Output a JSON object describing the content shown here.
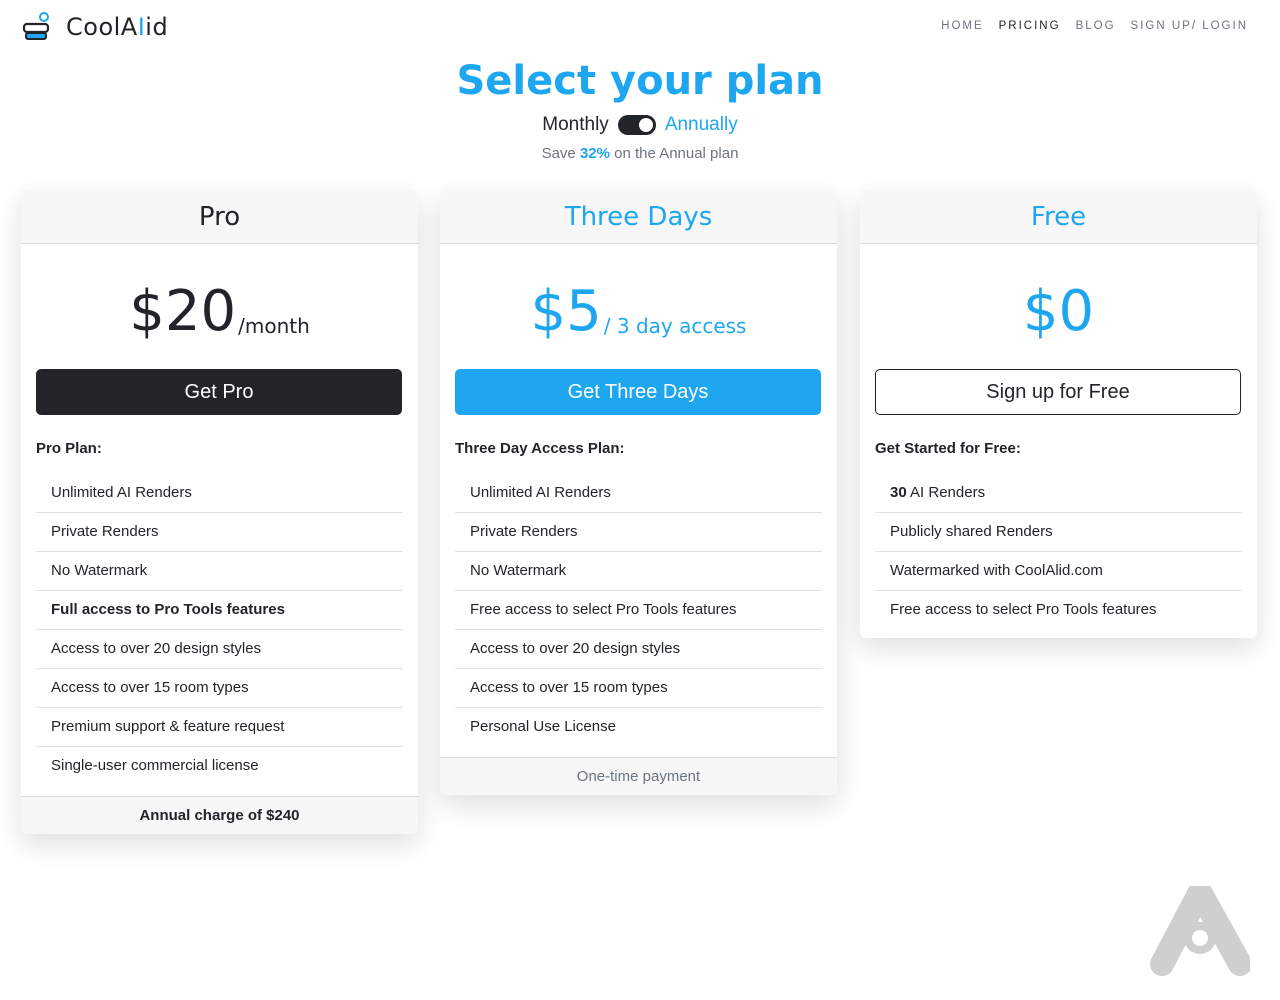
{
  "brand": {
    "name_prefix": "CoolA",
    "name_accent": "I",
    "name_suffix": "id",
    "accent_color": "#1ea7f0"
  },
  "nav": [
    {
      "label": "HOME"
    },
    {
      "label": "PRICING"
    },
    {
      "label": "BLOG"
    },
    {
      "label": "SIGN UP/ LOGIN"
    }
  ],
  "hero": {
    "title": "Select your plan",
    "toggle_monthly": "Monthly",
    "toggle_annually": "Annually",
    "save_prefix": "Save",
    "save_percent": "32%",
    "save_suffix": "on the Annual plan"
  },
  "plans": [
    {
      "name": "Pro",
      "price": "$20",
      "period": "/month",
      "button": "Get Pro",
      "plan_title": "Pro Plan:",
      "features": [
        "Unlimited AI Renders",
        "Private Renders",
        "No Watermark",
        "Full access to Pro Tools features",
        "Access to over 20 design styles",
        "Access to over 15 room types",
        "Premium support & feature request",
        "Single-user commercial license"
      ],
      "footer": "Annual charge of $240"
    },
    {
      "name": "Three Days",
      "price": "$5",
      "period": "/ 3 day access",
      "button": "Get Three Days",
      "plan_title": "Three Day Access Plan:",
      "features": [
        "Unlimited AI Renders",
        "Private Renders",
        "No Watermark",
        "Free access to select Pro Tools features",
        "Access to over 20 design styles",
        "Access to over 15 room types",
        "Personal Use License"
      ],
      "footer": "One-time payment"
    },
    {
      "name": "Free",
      "price": "$0",
      "button": "Sign up for Free",
      "plan_title": "Get Started for Free:",
      "features": [
        "30",
        "AI Renders",
        "Publicly shared Renders",
        "Watermarked with CoolAlid.com",
        "Free access to select Pro Tools features"
      ]
    }
  ]
}
